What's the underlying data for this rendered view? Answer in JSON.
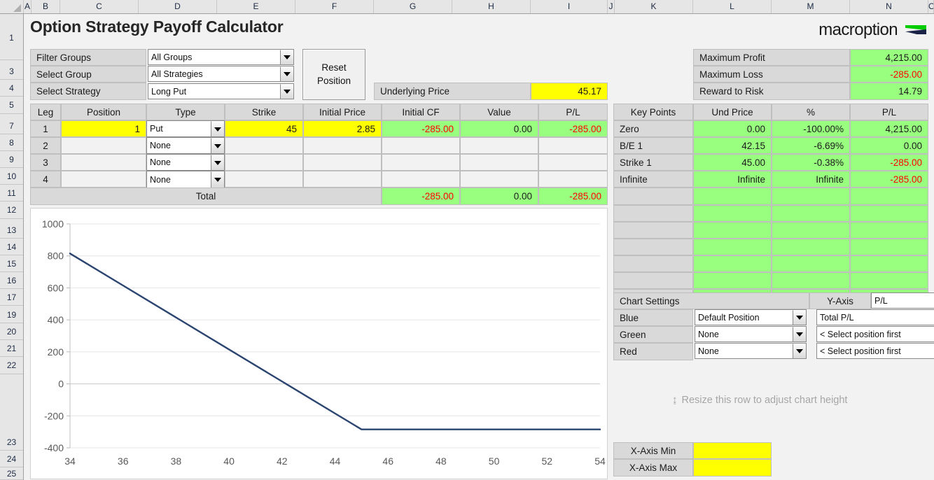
{
  "sheet": {
    "column_headers": [
      "A",
      "B",
      "C",
      "D",
      "E",
      "F",
      "G",
      "H",
      "I",
      "J",
      "K",
      "L",
      "M",
      "N",
      "O"
    ],
    "row_headers": [
      "1",
      "3",
      "4",
      "5",
      "7",
      "8",
      "9",
      "10",
      "11",
      "12",
      "13",
      "14",
      "15",
      "16",
      "17",
      "19",
      "20",
      "21",
      "22",
      "23",
      "24",
      "25"
    ]
  },
  "header": {
    "title": "Option Strategy Payoff Calculator",
    "logo_word": "macroption"
  },
  "selectors": {
    "filter_groups_label": "Filter Groups",
    "filter_groups_value": "All Groups",
    "select_group_label": "Select Group",
    "select_group_value": "All Strategies",
    "select_strategy_label": "Select Strategy",
    "select_strategy_value": "Long Put",
    "reset_button_line1": "Reset",
    "reset_button_line2": "Position"
  },
  "underlying": {
    "label": "Underlying Price",
    "value": "45.17"
  },
  "summary": {
    "rows": [
      {
        "label": "Maximum Profit",
        "value": "4,215.00",
        "negative": false
      },
      {
        "label": "Maximum Loss",
        "value": "-285.00",
        "negative": true
      },
      {
        "label": "Reward to Risk",
        "value": "14.79",
        "negative": false
      }
    ]
  },
  "legs_table": {
    "headers": [
      "Leg",
      "Position",
      "Type",
      "Strike",
      "Initial Price",
      "Initial CF",
      "Value",
      "P/L"
    ],
    "rows": [
      {
        "leg": "1",
        "position": "1",
        "type": "Put",
        "strike": "45",
        "initial_price": "2.85",
        "initial_cf": "-285.00",
        "value": "0.00",
        "pl": "-285.00",
        "active": true,
        "cf_negative": true,
        "pl_negative": true
      },
      {
        "leg": "2",
        "position": "",
        "type": "None",
        "strike": "",
        "initial_price": "",
        "initial_cf": "",
        "value": "",
        "pl": "",
        "active": false
      },
      {
        "leg": "3",
        "position": "",
        "type": "None",
        "strike": "",
        "initial_price": "",
        "initial_cf": "",
        "value": "",
        "pl": "",
        "active": false
      },
      {
        "leg": "4",
        "position": "",
        "type": "None",
        "strike": "",
        "initial_price": "",
        "initial_cf": "",
        "value": "",
        "pl": "",
        "active": false
      }
    ],
    "total": {
      "label": "Total",
      "initial_cf": "-285.00",
      "value": "0.00",
      "pl": "-285.00"
    }
  },
  "key_points": {
    "headers": [
      "Key Points",
      "Und Price",
      "%",
      "P/L"
    ],
    "rows": [
      {
        "name": "Zero",
        "und_price": "0.00",
        "pct": "-100.00%",
        "pl": "4,215.00",
        "pl_negative": false
      },
      {
        "name": "B/E 1",
        "und_price": "42.15",
        "pct": "-6.69%",
        "pl": "0.00",
        "pl_negative": false
      },
      {
        "name": "Strike 1",
        "und_price": "45.00",
        "pct": "-0.38%",
        "pl": "-285.00",
        "pl_negative": true
      },
      {
        "name": "Infinite",
        "und_price": "Infinite",
        "pct": "Infinite",
        "pl": "-285.00",
        "pl_negative": true
      },
      {
        "name": "",
        "und_price": "",
        "pct": "",
        "pl": "",
        "pl_negative": false
      },
      {
        "name": "",
        "und_price": "",
        "pct": "",
        "pl": "",
        "pl_negative": false
      },
      {
        "name": "",
        "und_price": "",
        "pct": "",
        "pl": "",
        "pl_negative": false
      },
      {
        "name": "",
        "und_price": "",
        "pct": "",
        "pl": "",
        "pl_negative": false
      },
      {
        "name": "",
        "und_price": "",
        "pct": "",
        "pl": "",
        "pl_negative": false
      },
      {
        "name": "",
        "und_price": "",
        "pct": "",
        "pl": "",
        "pl_negative": false
      },
      {
        "name": "",
        "und_price": "",
        "pct": "",
        "pl": "",
        "pl_negative": false
      }
    ]
  },
  "chart_settings": {
    "title": "Chart Settings",
    "y_axis_label": "Y-Axis",
    "y_axis_value": "P/L",
    "rows": [
      {
        "color_label": "Blue",
        "position_value": "Default Position",
        "series_value": "Total P/L"
      },
      {
        "color_label": "Green",
        "position_value": "None",
        "series_value": "< Select position first"
      },
      {
        "color_label": "Red",
        "position_value": "None",
        "series_value": "< Select position first"
      }
    ]
  },
  "resize_hint": {
    "text": "Resize this row to adjust chart height",
    "arrow_glyph": "↨"
  },
  "axis_controls": {
    "rows": [
      {
        "label": "X-Axis Min",
        "value": ""
      },
      {
        "label": "X-Axis Max",
        "value": ""
      }
    ]
  },
  "colors": {
    "green_fill": "#99ff7f",
    "yellow_fill": "#ffff00",
    "label_fill": "#d9d9d9",
    "negative_text": "#ff0000",
    "chart_line": "#2b4570",
    "logo_green": "#00cc00",
    "logo_navy": "#1a2347"
  },
  "chart_data": {
    "type": "line",
    "title": "",
    "xlabel": "",
    "ylabel": "",
    "xlim": [
      34,
      54
    ],
    "ylim": [
      -400,
      1000
    ],
    "xticks": [
      34,
      36,
      38,
      40,
      42,
      44,
      46,
      48,
      50,
      52,
      54
    ],
    "yticks": [
      -400,
      -200,
      0,
      200,
      400,
      600,
      800,
      1000
    ],
    "grid": true,
    "legend": "none",
    "series": [
      {
        "name": "Total P/L",
        "color": "#2b4570",
        "x": [
          34,
          36,
          38,
          40,
          42,
          42.15,
          44,
          45,
          46,
          48,
          50,
          52,
          54
        ],
        "y": [
          815,
          615,
          415,
          215,
          15,
          0,
          -185,
          -285,
          -285,
          -285,
          -285,
          -285,
          -285
        ]
      }
    ]
  }
}
